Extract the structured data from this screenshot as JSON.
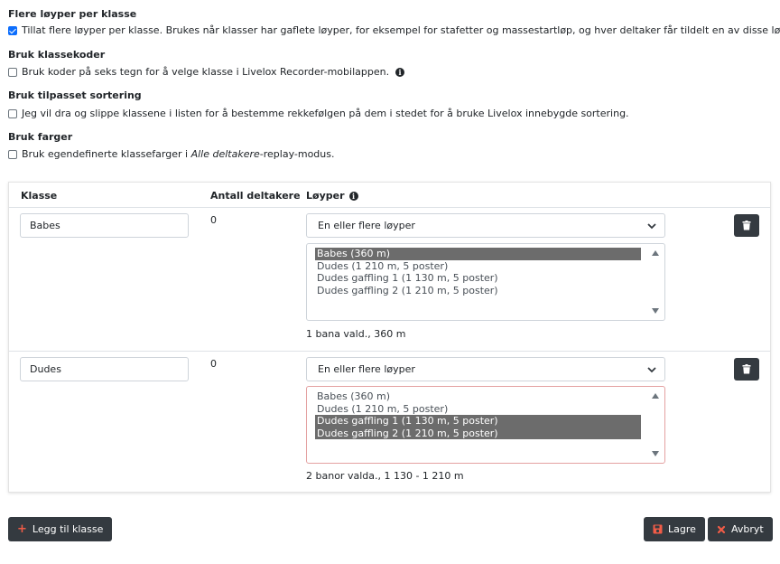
{
  "settings": {
    "multi_courses": {
      "heading": "Flere løyper per klasse",
      "checked": true,
      "label": "Tillat flere løyper per klasse. Brukes når klasser har gaflete løyper, for eksempel for stafetter og massestartløp, og hver deltaker får tildelt en av disse løypene."
    },
    "class_codes": {
      "heading": "Bruk klassekoder",
      "checked": false,
      "label": "Bruk koder på seks tegn for å velge klasse i Livelox Recorder-mobilappen.",
      "icon": "info-icon"
    },
    "custom_sort": {
      "heading": "Bruk tilpasset sortering",
      "checked": false,
      "label": "Jeg vil dra og slippe klassene i listen for å bestemme rekkefølgen på dem i stedet for å bruke Livelox innebygde sortering."
    },
    "colors": {
      "heading": "Bruk farger",
      "checked": false,
      "label_before": "Bruk egendefinerte klassefarger i ",
      "label_italic": "Alle deltakere",
      "label_after": "-replay-modus."
    }
  },
  "table": {
    "headers": {
      "klasse": "Klasse",
      "antall": "Antall deltakere",
      "loyper": "Løyper"
    },
    "rows": [
      {
        "class_name": "Babes",
        "count": "0",
        "select_value": "En eller flere løyper",
        "options": [
          {
            "label": "Babes (360 m)",
            "selected": true
          },
          {
            "label": "Dudes (1 210 m, 5 poster)",
            "selected": false
          },
          {
            "label": "Dudes gaffling 1 (1 130 m, 5 poster)",
            "selected": false
          },
          {
            "label": "Dudes gaffling 2 (1 210 m, 5 poster)",
            "selected": false
          }
        ],
        "summary": "1 bana vald., 360 m"
      },
      {
        "class_name": "Dudes",
        "count": "0",
        "select_value": "En eller flere løyper",
        "options": [
          {
            "label": "Babes (360 m)",
            "selected": false
          },
          {
            "label": "Dudes (1 210 m, 5 poster)",
            "selected": false
          },
          {
            "label": "Dudes gaffling 1 (1 130 m, 5 poster)",
            "selected": true
          },
          {
            "label": "Dudes gaffling 2 (1 210 m, 5 poster)",
            "selected": true
          }
        ],
        "summary": "2 banor valda., 1 130 - 1 210 m"
      }
    ]
  },
  "footer": {
    "add_class": "Legg til klasse",
    "save": "Lagre",
    "cancel": "Avbryt"
  },
  "colors": {
    "accent_red": "#f15c47",
    "dark_button": "#343a40",
    "checkbox_blue": "#0d6efd"
  }
}
